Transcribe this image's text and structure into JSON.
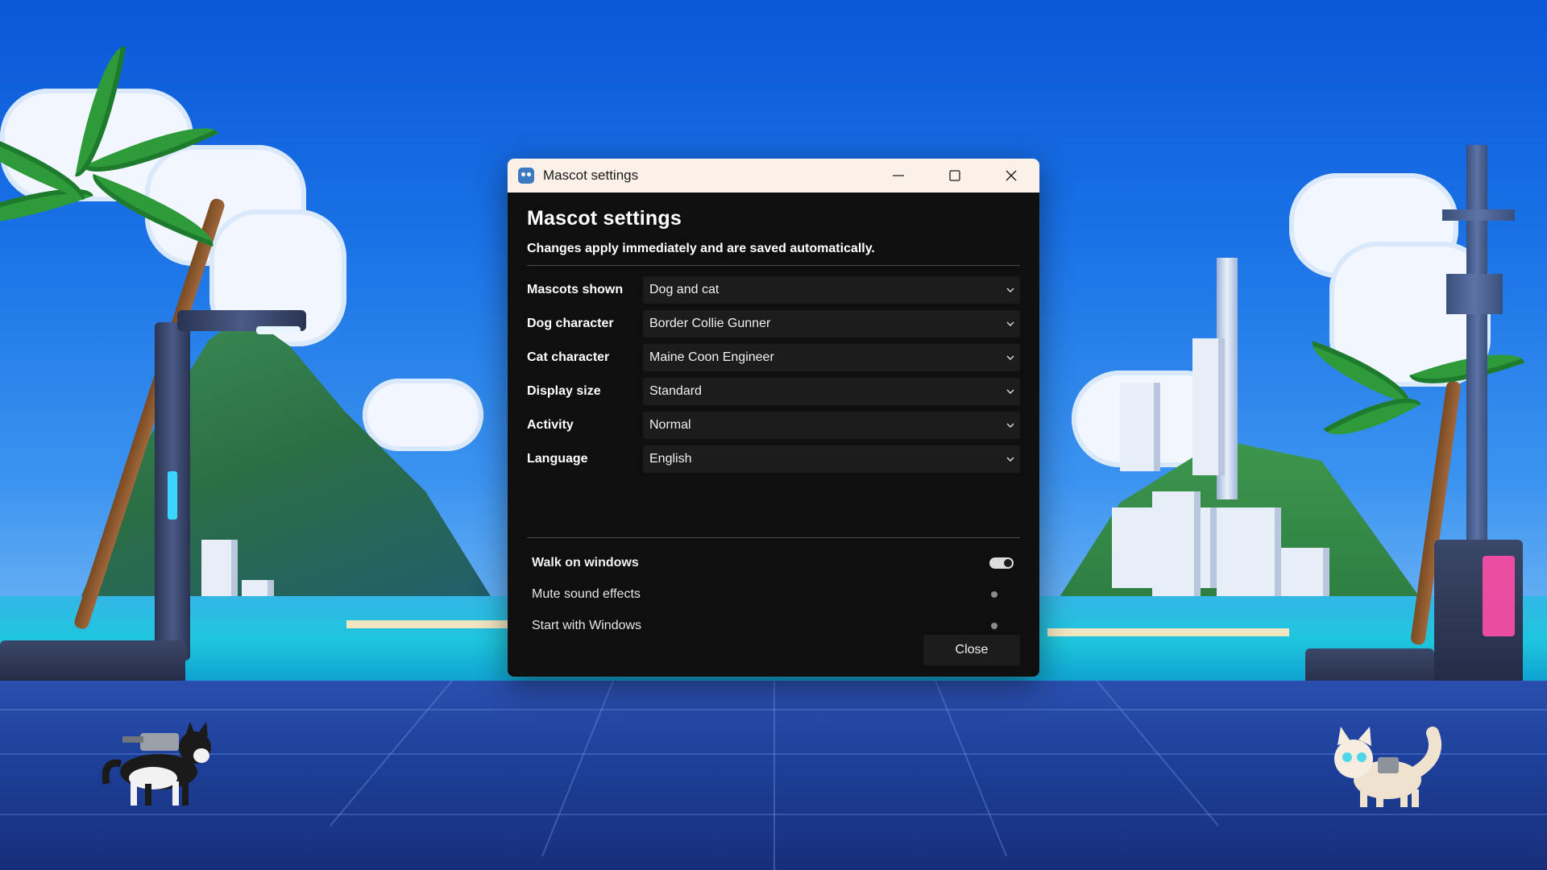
{
  "window": {
    "title": "Mascot settings",
    "icon": "godot-robot-icon",
    "controls": [
      "minimize-icon",
      "maximize-icon",
      "close-icon"
    ]
  },
  "page": {
    "heading": "Mascot settings",
    "subtitle": "Changes apply immediately and are saved automatically."
  },
  "settings": [
    {
      "label": "Mascots shown",
      "value": "Dog and cat"
    },
    {
      "label": "Dog character",
      "value": "Border Collie Gunner"
    },
    {
      "label": "Cat character",
      "value": "Maine Coon Engineer"
    },
    {
      "label": "Display size",
      "value": "Standard"
    },
    {
      "label": "Activity",
      "value": "Normal"
    },
    {
      "label": "Language",
      "value": "English"
    }
  ],
  "toggles": [
    {
      "label": "Walk on windows",
      "on": true
    },
    {
      "label": "Mute sound effects",
      "on": false
    },
    {
      "label": "Start with Windows",
      "on": false
    }
  ],
  "footer": {
    "close_label": "Close"
  },
  "desktop": {
    "mascots": [
      "border-collie-mascot",
      "maine-coon-mascot"
    ]
  },
  "colors": {
    "titlebar": "#fbf1e8",
    "window_bg": "#0f0f0f",
    "control_bg": "#1c1c1c",
    "sky": "#1a72e6",
    "sea": "#1ec6dd",
    "floor": "#1d3f98"
  }
}
